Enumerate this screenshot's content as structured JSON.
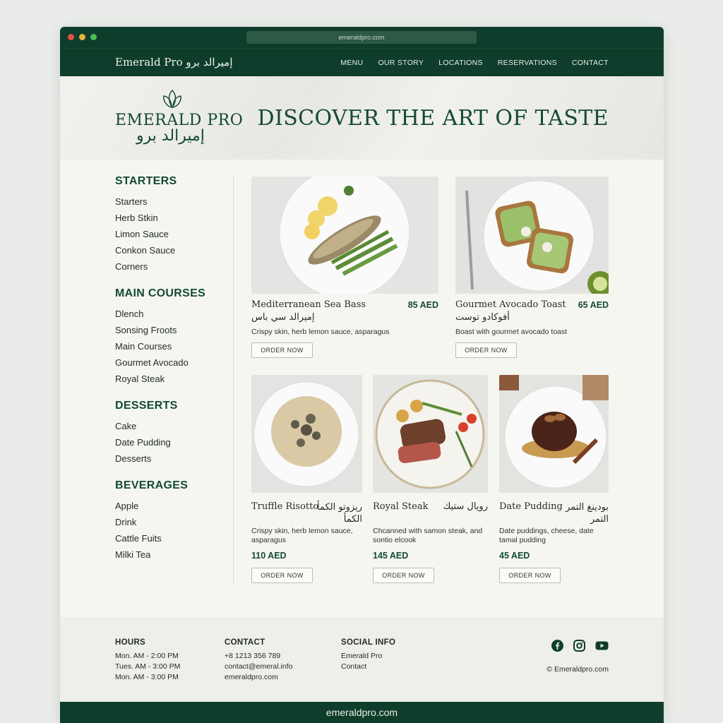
{
  "browser": {
    "url": "emeraldpro.com"
  },
  "nav": {
    "brand": "Emerald Pro إميرالد برو",
    "links": [
      "MENU",
      "OUR STORY",
      "LOCATIONS",
      "RESERVATIONS",
      "CONTACT"
    ]
  },
  "hero": {
    "logo_name": "EMERALD PRO",
    "logo_arabic": "إميرالد برو",
    "title": "DISCOVER THE ART OF TASTE"
  },
  "sidebar": {
    "categories": [
      {
        "title": "STARTERS",
        "items": [
          "Starters",
          "Herb Stkin",
          "Limon Sauce",
          "Conkon Sauce",
          "Corners"
        ]
      },
      {
        "title": "MAIN COURSES",
        "items": [
          "Dlench",
          "Sonsing Froots",
          "Main Courses",
          "Gourmet Avocado",
          "Royal Steak"
        ]
      },
      {
        "title": "DESSERTS",
        "items": [
          "Cake",
          "Date Pudding",
          "Desserts"
        ]
      },
      {
        "title": "BEVERAGES",
        "items": [
          "Apple",
          "Drink",
          "Cattle Fuits",
          "Milki Tea"
        ]
      }
    ]
  },
  "dishes": [
    {
      "name": "Mediterranean Sea Bass",
      "arabic": "إميرالد سي باس",
      "price": "85 AED",
      "desc": "Crispy skin, herb lemon sauce, asparagus",
      "button": "ORDER NOW"
    },
    {
      "name": "Gourmet Avocado Toast",
      "arabic": "أفوكادو توست",
      "price": "65 AED",
      "desc": "Boast with gourmet avocado toast",
      "button": "ORDER NOW"
    },
    {
      "name": "Truffle Risotto",
      "arabic": "ريزوتو الكمأ الكمأ",
      "price": "110 AED",
      "desc": "Crispy skin, herb lemon sauce, asparagus",
      "button": "ORDER NOW"
    },
    {
      "name": "Royal Steak",
      "arabic": "رويال ستيك",
      "price": "145 AED",
      "desc": "Chcanned with samon steak, and sontio elcook",
      "button": "ORDER NOW"
    },
    {
      "name": "Date Pudding",
      "arabic": "بودينغ التمر التمر",
      "price": "45 AED",
      "desc": "Date puddings, cheese, date tamal pudding",
      "button": "ORDER NOW"
    }
  ],
  "footer": {
    "hours": {
      "title": "HOURS",
      "lines": [
        "Mon. AM - 2:00 PM",
        "Tues. AM - 3:00 PM",
        "Mon. AM - 3:00 PM"
      ]
    },
    "contact": {
      "title": "CONTACT",
      "lines": [
        "+8 1213 356 789",
        "contact@emeral.info",
        "emeraldpro.com"
      ]
    },
    "social": {
      "title": "SOCIAL INFO",
      "lines": [
        "Emerald Pro",
        "Contact"
      ]
    },
    "icons": [
      "facebook-icon",
      "instagram-icon",
      "youtube-icon"
    ],
    "copyright": "© Emeraldpro.com",
    "bottom_url": "emeraldpro.com"
  },
  "colors": {
    "primary": "#0f3d2b",
    "accent_text": "#134a33",
    "page_bg": "#f6f6f1"
  }
}
